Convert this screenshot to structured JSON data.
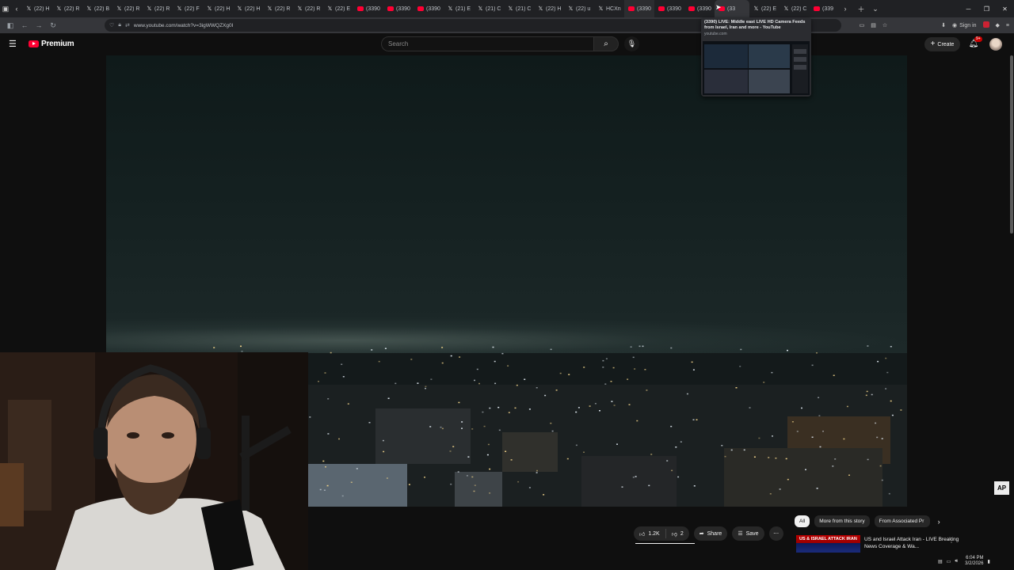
{
  "browser": {
    "tabs": [
      {
        "title": "(22) H",
        "fav": "x-logo"
      },
      {
        "title": "(22) R",
        "fav": "x-logo"
      },
      {
        "title": "(22) B",
        "fav": "x-logo"
      },
      {
        "title": "(22) R",
        "fav": "x-logo"
      },
      {
        "title": "(22) R",
        "fav": "x-logo"
      },
      {
        "title": "(22) F",
        "fav": "x-logo"
      },
      {
        "title": "(22) H",
        "fav": "x-logo"
      },
      {
        "title": "(22) H",
        "fav": "x-logo"
      },
      {
        "title": "(22) R",
        "fav": "x-logo"
      },
      {
        "title": "(22) R",
        "fav": "x-logo"
      },
      {
        "title": "(22) E",
        "fav": "x-logo"
      },
      {
        "title": "(3390",
        "fav": "youtube-logo"
      },
      {
        "title": "(3390",
        "fav": "youtube-logo"
      },
      {
        "title": "(3390",
        "fav": "youtube-logo"
      },
      {
        "title": "(21) E",
        "fav": "x-logo"
      },
      {
        "title": "(21) C",
        "fav": "x-logo"
      },
      {
        "title": "(21) C",
        "fav": "x-logo"
      },
      {
        "title": "(22) H",
        "fav": "x-logo"
      },
      {
        "title": "(22) u",
        "fav": "x-logo"
      },
      {
        "title": "HCXn",
        "fav": "x-logo"
      },
      {
        "title": "(3390",
        "fav": "youtube-logo"
      },
      {
        "title": "(3390",
        "fav": "youtube-logo"
      },
      {
        "title": "(3390",
        "fav": "youtube-logo"
      },
      {
        "title": "(33",
        "fav": "youtube-logo"
      },
      {
        "title": "(22) E",
        "fav": "x-logo"
      },
      {
        "title": "(22) C",
        "fav": "x-logo"
      },
      {
        "title": "(339",
        "fav": "youtube-logo"
      }
    ],
    "active_tab_index": 23,
    "url": "www.youtube.com/watch?v=3igWWQZXg0I",
    "sign_in": "Sign in",
    "tab_preview": {
      "title": "(3390) LIVE: Middle east LIVE HD Camera Feeds from Israel, Iran and more - YouTube",
      "domain": "youtube.com"
    }
  },
  "youtube": {
    "logo_text": "Premium",
    "search_placeholder": "Search",
    "create_label": "Create",
    "notifications_badge": "9+",
    "video_watermark": "AP",
    "actions": {
      "likes": "1.2K",
      "dislikes": "2",
      "share": "Share",
      "save": "Save"
    },
    "chips": [
      "All",
      "More from this story",
      "From Associated Pr"
    ],
    "recommendation": {
      "thumb_text": "US & ISRAEL ATTACK IRAN",
      "title": "US and Israel Attack Iran - LIVE Breaking News Coverage & Wa..."
    }
  },
  "taskbar": {
    "time": "6:04 PM",
    "date": "3/2/2026"
  },
  "colors": {
    "youtube_red": "#ff0033",
    "page_bg": "#0f0f0f",
    "chip_bg": "#272727"
  }
}
